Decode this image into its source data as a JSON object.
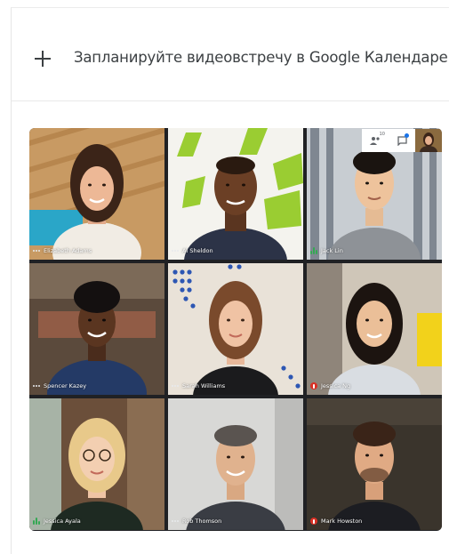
{
  "menu": {
    "schedule_label": "Запланируйте видеовстречу в Google Календаре",
    "icon": "plus-icon"
  },
  "toolbar": {
    "people_icon": "people-icon",
    "people_count": "10",
    "chat_icon": "chat-icon",
    "chat_badge_color": "#1a73e8"
  },
  "participants": [
    {
      "name": "Elizabeth Adams",
      "mic": "idle"
    },
    {
      "name": "Al Sheldon",
      "mic": "idle"
    },
    {
      "name": "Jack Lin",
      "mic": "speaking"
    },
    {
      "name": "Spencer Kazey",
      "mic": "idle"
    },
    {
      "name": "Sarah Williams",
      "mic": "idle"
    },
    {
      "name": "Jessica Ng",
      "mic": "muted"
    },
    {
      "name": "Jessica Ayala",
      "mic": "speaking"
    },
    {
      "name": "Rob Thomson",
      "mic": "idle"
    },
    {
      "name": "Mark Howston",
      "mic": "muted"
    }
  ],
  "colors": {
    "mic_active": "#34a853",
    "mic_muted": "#d93025",
    "text_primary": "#3c4043"
  }
}
